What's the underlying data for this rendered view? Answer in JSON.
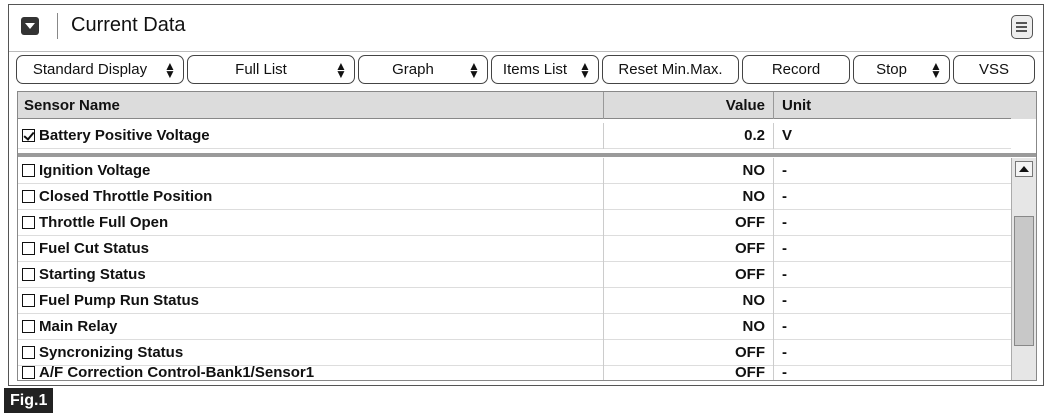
{
  "window": {
    "title": "Current Data"
  },
  "toolbar": {
    "buttons": [
      {
        "label": "Standard Display",
        "dropdown": true
      },
      {
        "label": "Full List",
        "dropdown": true
      },
      {
        "label": "Graph",
        "dropdown": true
      },
      {
        "label": "Items List",
        "dropdown": true
      },
      {
        "label": "Reset Min.Max.",
        "dropdown": false
      },
      {
        "label": "Record",
        "dropdown": false
      },
      {
        "label": "Stop",
        "dropdown": true
      },
      {
        "label": "VSS",
        "dropdown": false
      }
    ]
  },
  "table": {
    "headers": {
      "name": "Sensor Name",
      "value": "Value",
      "unit": "Unit"
    },
    "pinned_rows": [
      {
        "name": "Battery Positive Voltage",
        "value": "0.2",
        "unit": "V",
        "checked": true
      }
    ],
    "rows": [
      {
        "name": "Ignition Voltage",
        "value": "NO",
        "unit": "-",
        "checked": false
      },
      {
        "name": "Closed Throttle Position",
        "value": "NO",
        "unit": "-",
        "checked": false
      },
      {
        "name": "Throttle Full Open",
        "value": "OFF",
        "unit": "-",
        "checked": false
      },
      {
        "name": "Fuel Cut Status",
        "value": "OFF",
        "unit": "-",
        "checked": false
      },
      {
        "name": "Starting Status",
        "value": "OFF",
        "unit": "-",
        "checked": false
      },
      {
        "name": "Fuel Pump Run Status",
        "value": "NO",
        "unit": "-",
        "checked": false
      },
      {
        "name": "Main Relay",
        "value": "NO",
        "unit": "-",
        "checked": false
      },
      {
        "name": "Syncronizing Status",
        "value": "OFF",
        "unit": "-",
        "checked": false
      },
      {
        "name": "A/F Correction Control-Bank1/Sensor1",
        "value": "OFF",
        "unit": "-",
        "checked": false
      }
    ]
  },
  "figure": {
    "label": "Fig.1"
  }
}
